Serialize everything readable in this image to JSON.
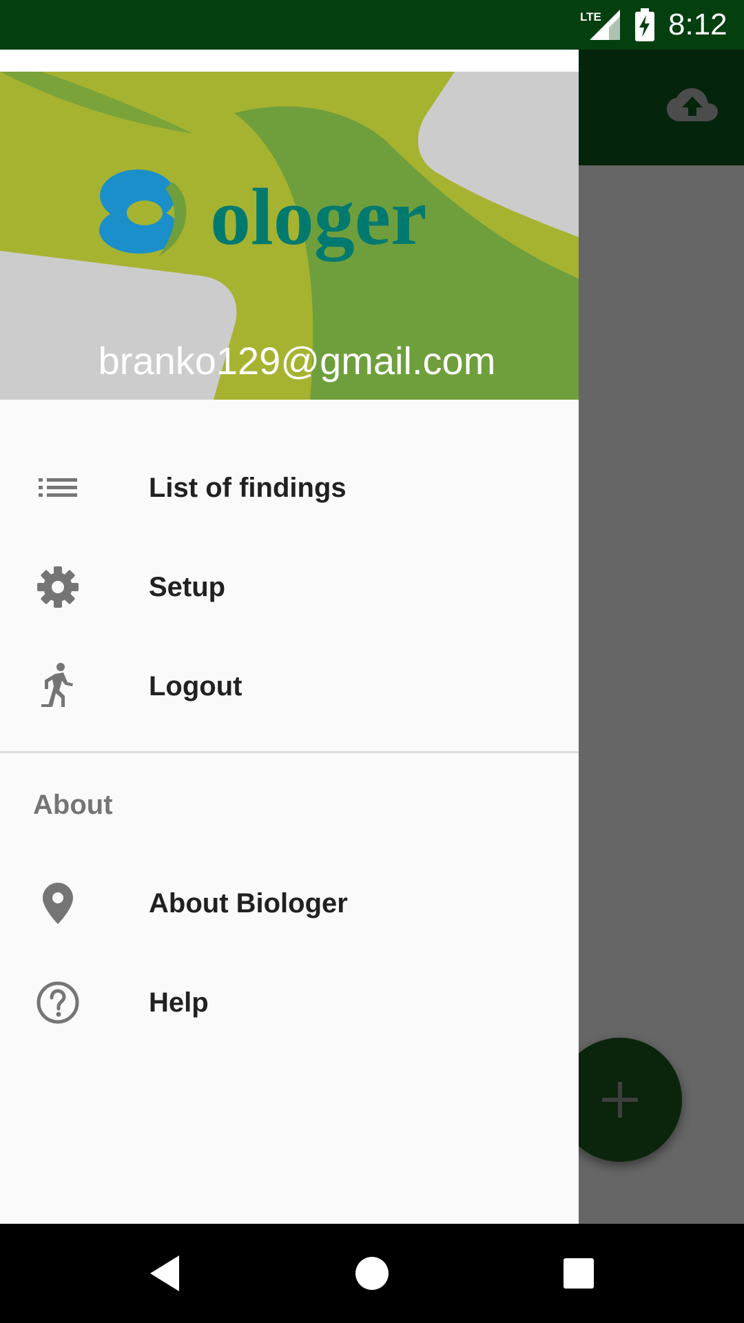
{
  "status_bar": {
    "network": "LTE",
    "time": "8:12"
  },
  "drawer": {
    "logo_text": "Biologer",
    "account_email": "branko129@gmail.com",
    "items": [
      {
        "label": "List of findings",
        "icon": "list-icon"
      },
      {
        "label": "Setup",
        "icon": "gear-icon"
      },
      {
        "label": "Logout",
        "icon": "running-person-icon"
      }
    ],
    "section_header": "About",
    "about_items": [
      {
        "label": "About Biologer",
        "icon": "location-pin-icon"
      },
      {
        "label": "Help",
        "icon": "help-circle-icon"
      }
    ]
  },
  "colors": {
    "status_bar": "#043f10",
    "toolbar": "#0c5a1e",
    "fab": "#1b5e20",
    "header_olive": "#a6b330",
    "header_green": "#6f9f3c",
    "header_gray": "#cccccc",
    "logo_blue": "#1a8fca",
    "logo_teal": "#007a6f"
  }
}
